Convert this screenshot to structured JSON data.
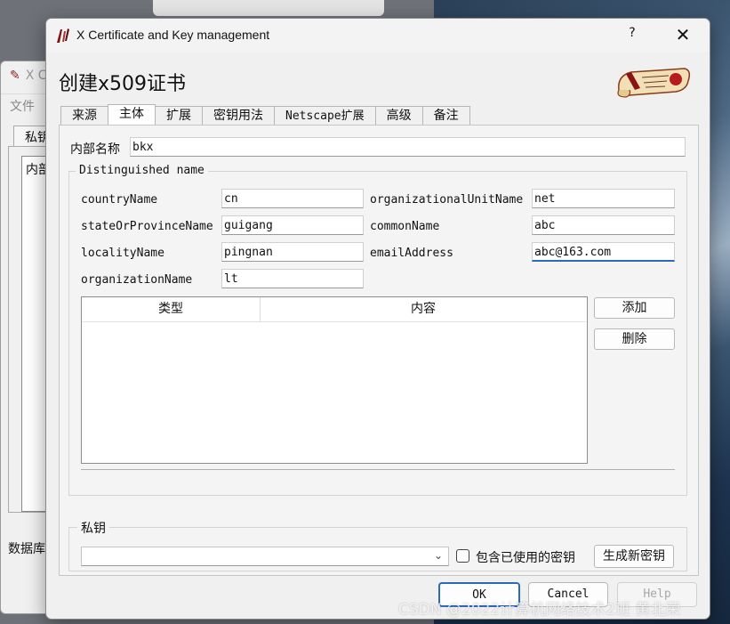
{
  "background_window": {
    "title": "X C",
    "menu_file": "文件",
    "tab_label": "私钥",
    "panel_label": "内部",
    "status_label": "数据库"
  },
  "dialog": {
    "title": "X Certificate and Key management",
    "help_glyph": "?",
    "close_glyph": "✕",
    "heading": "创建x509证书",
    "tabs": [
      {
        "label": "来源",
        "active": false
      },
      {
        "label": "主体",
        "active": true
      },
      {
        "label": "扩展",
        "active": false
      },
      {
        "label": "密钥用法",
        "active": false
      },
      {
        "label": "Netscape扩展",
        "active": false
      },
      {
        "label": "高级",
        "active": false
      },
      {
        "label": "备注",
        "active": false
      }
    ],
    "internal_name": {
      "label": "内部名称",
      "value": "bkx"
    },
    "dn_group_title": "Distinguished name",
    "dn_fields": {
      "countryName": {
        "label": "countryName",
        "value": "cn"
      },
      "stateOrProvinceName": {
        "label": "stateOrProvinceName",
        "value": "guigang"
      },
      "localityName": {
        "label": "localityName",
        "value": "pingnan"
      },
      "organizationName": {
        "label": "organizationName",
        "value": "lt"
      },
      "organizationalUnitName": {
        "label": "organizationalUnitName",
        "value": "net"
      },
      "commonName": {
        "label": "commonName",
        "value": "abc"
      },
      "emailAddress": {
        "label": "emailAddress",
        "value": "abc@163.com"
      }
    },
    "table": {
      "columns": [
        "类型",
        "内容"
      ],
      "rows": []
    },
    "add_button": "添加",
    "delete_button": "删除",
    "private_key_group_title": "私钥",
    "private_key_combo_value": "",
    "include_used_keys_label": "包含已使用的密钥",
    "include_used_keys_checked": false,
    "generate_key_button": "生成新密钥",
    "ok_button": "OK",
    "cancel_button": "Cancel",
    "help_button": "Help"
  },
  "watermark": "CSDN @2022计算机网络技术2班 黄北荣",
  "colors": {
    "accent": "#2a6ab8",
    "dialog_bg": "#f0f0f0"
  }
}
